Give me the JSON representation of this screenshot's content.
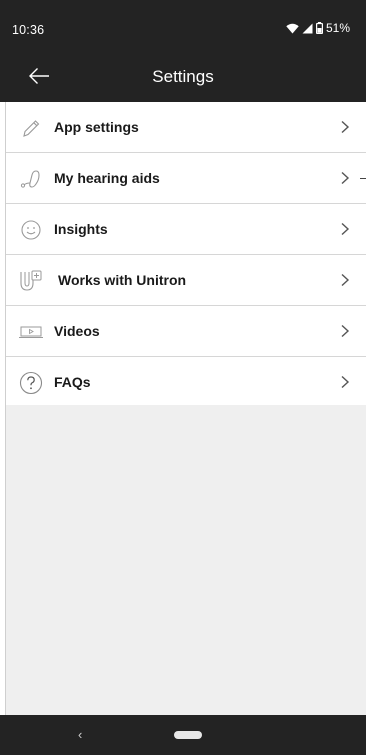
{
  "status_bar": {
    "time": "10:36",
    "battery": "51%",
    "icons": [
      "wifi-icon",
      "cell-signal-icon",
      "battery-icon"
    ]
  },
  "app_bar": {
    "title": "Settings",
    "back_icon": "arrow-left-icon"
  },
  "menu": {
    "items": [
      {
        "label": "App settings",
        "icon": "pencil-icon"
      },
      {
        "label": "My hearing aids",
        "icon": "hearing-aid-icon"
      },
      {
        "label": "Insights",
        "icon": "smiley-icon"
      },
      {
        "label": "Works with Unitron",
        "icon": "unitron-icon"
      },
      {
        "label": "Videos",
        "icon": "video-icon"
      },
      {
        "label": "FAQs",
        "icon": "question-icon"
      }
    ],
    "chevron_icon": "chevron-right-icon"
  },
  "nav_bar": {
    "back_glyph": "‹"
  },
  "colors": {
    "bar_background": "#232323",
    "list_background": "#ffffff",
    "page_background": "#efefef",
    "icon_stroke": "#9a9a9a"
  }
}
